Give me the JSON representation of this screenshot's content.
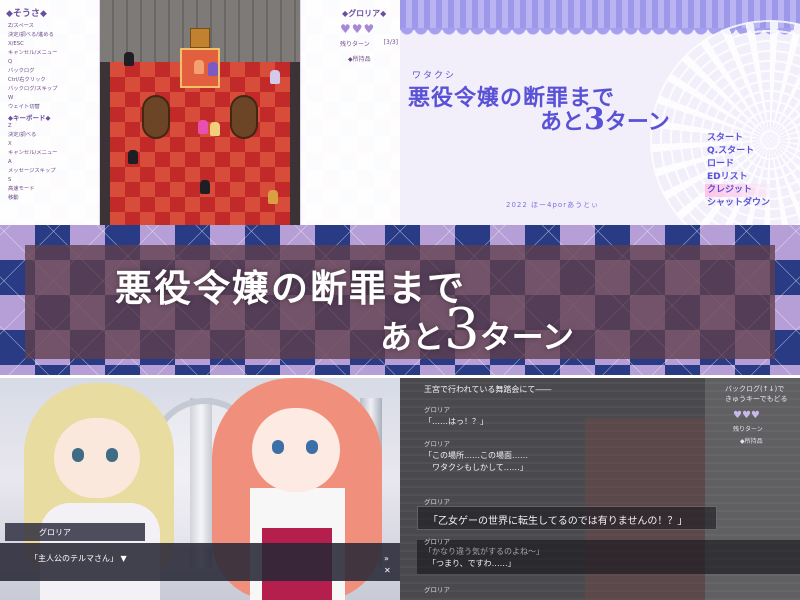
{
  "panel_top_left": {
    "controls_title": "そうさ",
    "controls": [
      "Z/スペース",
      "決定/調べる/進める",
      "X/ESC",
      "キャンセル/メニュー",
      "Q",
      "バックログ",
      "Ctrl/右クリック",
      "バックログ/スキップ",
      "W",
      "ウェイト切替"
    ],
    "keyboard_title": "キーボード",
    "keyboard": [
      "Z",
      "決定/調べる",
      "X",
      "キャンセル/メニュー",
      "A",
      "メッセージスキップ",
      "S",
      "高速モード",
      "移動"
    ],
    "character_name": "グロリア",
    "hearts": "♥♥♥",
    "turn_label": "残りターン",
    "turn_value": "[3/3]",
    "items_label": "所持品"
  },
  "panel_top_right": {
    "title_ruby": "ワタクシ",
    "title_line1": "悪役令嬢の断罪まで",
    "title_line2_pre": "あと",
    "title_line2_num": "3",
    "title_line2_post": "ターン",
    "menu": [
      "スタート",
      "Q.スタート",
      "ロード",
      "EDリスト",
      "クレジット",
      "シャットダウン"
    ],
    "selected_index": 4,
    "credit": "2022 ほー4porあうとぃ"
  },
  "banner": {
    "line1": "悪役令嬢の断罪まで",
    "line2_pre": "あと",
    "line2_num": "3",
    "line2_post": "ターン"
  },
  "panel_bottom_left": {
    "speaker": "グロリア",
    "dialogue": "「主人公のテルマさん」",
    "arrow": "▼",
    "icons": [
      "»",
      "✕"
    ]
  },
  "panel_bottom_right": {
    "help": [
      "バックログ(↑↓)で",
      "きゅうキーでもどる"
    ],
    "hearts": "♥♥♥",
    "turn": "残りターン",
    "items": "所持品",
    "entries": [
      {
        "name": "",
        "text": "王宮で行われている舞踏会にて――"
      },
      {
        "name": "グロリア",
        "text": "「……はっ！？」"
      },
      {
        "name": "グロリア",
        "text": "「この場所……この場面……"
      },
      {
        "name": "",
        "text": "　ワタクシもしかして……」"
      },
      {
        "name": "グロリア",
        "text": "「乙女ゲーの世界に転生してるのでは有りませんの！？」"
      },
      {
        "name": "グロリア",
        "text": "「かなり違う気がするのよね〜」"
      },
      {
        "name": "",
        "text": "「つまり、ですわ……」"
      },
      {
        "name": "グロリア",
        "text": ""
      }
    ]
  }
}
